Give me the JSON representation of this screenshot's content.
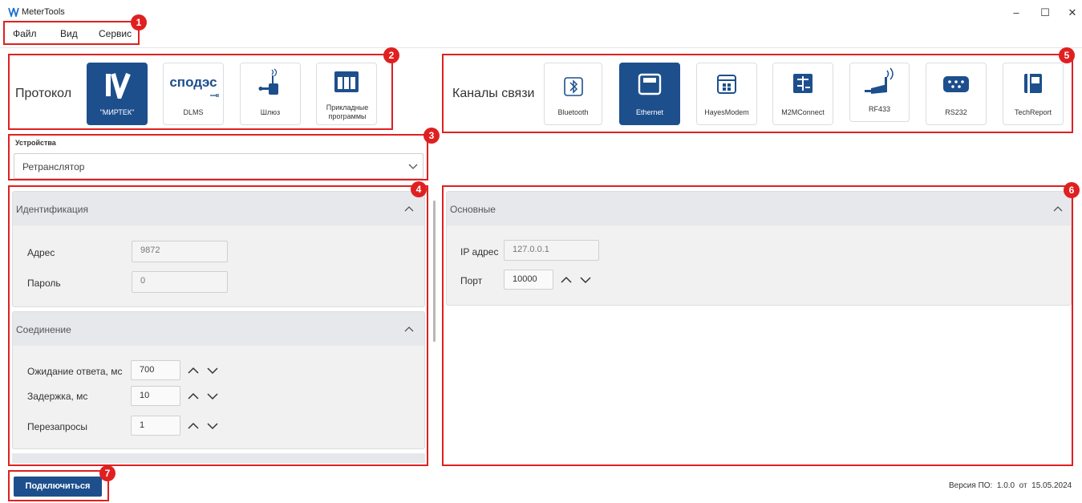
{
  "window": {
    "title": "MeterTools",
    "controls": {
      "minimize": "–",
      "maximize": "☐",
      "close": "✕"
    }
  },
  "menu": {
    "items": [
      "Файл",
      "Вид",
      "Сервис"
    ]
  },
  "annotations": [
    "1",
    "2",
    "3",
    "4",
    "5",
    "6",
    "7"
  ],
  "protocol": {
    "label": "Протокол",
    "selected": "\"МИРТЕК\"",
    "items": [
      {
        "label": "\"МИРТЕК\"",
        "icon": "mirtek-logo-icon"
      },
      {
        "label": "DLMS",
        "logo_text": "сподэс",
        "icon": "spodes-logo-icon"
      },
      {
        "label": "Шлюз",
        "icon": "gateway-icon"
      },
      {
        "label": "Прикладные программы",
        "icon": "applications-icon"
      }
    ]
  },
  "channels": {
    "label": "Каналы связи",
    "selected": "Ethernet",
    "items": [
      {
        "label": "Bluetooth",
        "icon": "bluetooth-icon"
      },
      {
        "label": "Ethernet",
        "icon": "ethernet-icon"
      },
      {
        "label": "HayesModem",
        "icon": "modem-icon"
      },
      {
        "label": "M2MConnect",
        "icon": "m2m-icon"
      },
      {
        "label": "RF433",
        "icon": "rf433-icon"
      },
      {
        "label": "RS232",
        "icon": "rs232-icon"
      },
      {
        "label": "TechReport",
        "icon": "techreport-icon"
      }
    ]
  },
  "devices": {
    "label": "Устройства",
    "selected": "Ретранслятор"
  },
  "identification": {
    "title": "Идентификация",
    "address_label": "Адрес",
    "address_value": "9872",
    "password_label": "Пароль",
    "password_value": "0"
  },
  "connection": {
    "title": "Соединение",
    "timeout_label": "Ожидание ответа, мс",
    "timeout_value": "700",
    "delay_label": "Задержка, мс",
    "delay_value": "10",
    "retries_label": "Перезапросы",
    "retries_value": "1"
  },
  "basic": {
    "title": "Основные",
    "ip_label": "IP адрес",
    "ip_value": "127.0.0.1",
    "port_label": "Порт",
    "port_value": "10000"
  },
  "footer": {
    "connect_button": "Подключиться",
    "version_text": "Версия ПО:  1.0.0  от  15.05.2024"
  },
  "colors": {
    "accent": "#1d4f8d",
    "annotation": "#e02020",
    "panel": "#f1f1f2",
    "panel_header": "#e6e8ec"
  }
}
